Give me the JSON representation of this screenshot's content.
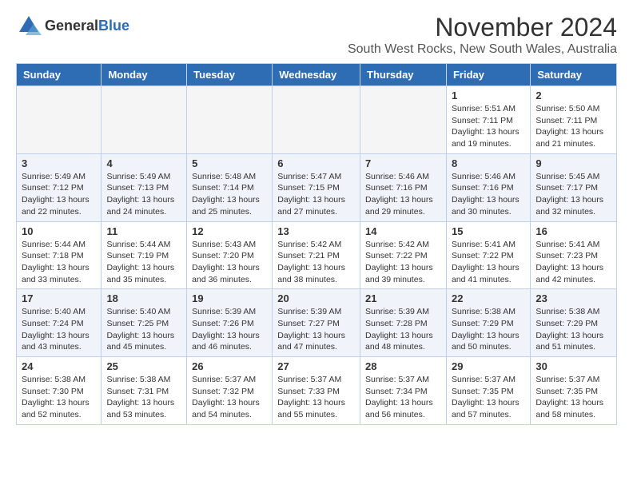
{
  "header": {
    "logo_general": "General",
    "logo_blue": "Blue",
    "month_title": "November 2024",
    "subtitle": "South West Rocks, New South Wales, Australia"
  },
  "days_of_week": [
    "Sunday",
    "Monday",
    "Tuesday",
    "Wednesday",
    "Thursday",
    "Friday",
    "Saturday"
  ],
  "weeks": [
    [
      {
        "day": "",
        "info": ""
      },
      {
        "day": "",
        "info": ""
      },
      {
        "day": "",
        "info": ""
      },
      {
        "day": "",
        "info": ""
      },
      {
        "day": "",
        "info": ""
      },
      {
        "day": "1",
        "info": "Sunrise: 5:51 AM\nSunset: 7:11 PM\nDaylight: 13 hours and 19 minutes."
      },
      {
        "day": "2",
        "info": "Sunrise: 5:50 AM\nSunset: 7:11 PM\nDaylight: 13 hours and 21 minutes."
      }
    ],
    [
      {
        "day": "3",
        "info": "Sunrise: 5:49 AM\nSunset: 7:12 PM\nDaylight: 13 hours and 22 minutes."
      },
      {
        "day": "4",
        "info": "Sunrise: 5:49 AM\nSunset: 7:13 PM\nDaylight: 13 hours and 24 minutes."
      },
      {
        "day": "5",
        "info": "Sunrise: 5:48 AM\nSunset: 7:14 PM\nDaylight: 13 hours and 25 minutes."
      },
      {
        "day": "6",
        "info": "Sunrise: 5:47 AM\nSunset: 7:15 PM\nDaylight: 13 hours and 27 minutes."
      },
      {
        "day": "7",
        "info": "Sunrise: 5:46 AM\nSunset: 7:16 PM\nDaylight: 13 hours and 29 minutes."
      },
      {
        "day": "8",
        "info": "Sunrise: 5:46 AM\nSunset: 7:16 PM\nDaylight: 13 hours and 30 minutes."
      },
      {
        "day": "9",
        "info": "Sunrise: 5:45 AM\nSunset: 7:17 PM\nDaylight: 13 hours and 32 minutes."
      }
    ],
    [
      {
        "day": "10",
        "info": "Sunrise: 5:44 AM\nSunset: 7:18 PM\nDaylight: 13 hours and 33 minutes."
      },
      {
        "day": "11",
        "info": "Sunrise: 5:44 AM\nSunset: 7:19 PM\nDaylight: 13 hours and 35 minutes."
      },
      {
        "day": "12",
        "info": "Sunrise: 5:43 AM\nSunset: 7:20 PM\nDaylight: 13 hours and 36 minutes."
      },
      {
        "day": "13",
        "info": "Sunrise: 5:42 AM\nSunset: 7:21 PM\nDaylight: 13 hours and 38 minutes."
      },
      {
        "day": "14",
        "info": "Sunrise: 5:42 AM\nSunset: 7:22 PM\nDaylight: 13 hours and 39 minutes."
      },
      {
        "day": "15",
        "info": "Sunrise: 5:41 AM\nSunset: 7:22 PM\nDaylight: 13 hours and 41 minutes."
      },
      {
        "day": "16",
        "info": "Sunrise: 5:41 AM\nSunset: 7:23 PM\nDaylight: 13 hours and 42 minutes."
      }
    ],
    [
      {
        "day": "17",
        "info": "Sunrise: 5:40 AM\nSunset: 7:24 PM\nDaylight: 13 hours and 43 minutes."
      },
      {
        "day": "18",
        "info": "Sunrise: 5:40 AM\nSunset: 7:25 PM\nDaylight: 13 hours and 45 minutes."
      },
      {
        "day": "19",
        "info": "Sunrise: 5:39 AM\nSunset: 7:26 PM\nDaylight: 13 hours and 46 minutes."
      },
      {
        "day": "20",
        "info": "Sunrise: 5:39 AM\nSunset: 7:27 PM\nDaylight: 13 hours and 47 minutes."
      },
      {
        "day": "21",
        "info": "Sunrise: 5:39 AM\nSunset: 7:28 PM\nDaylight: 13 hours and 48 minutes."
      },
      {
        "day": "22",
        "info": "Sunrise: 5:38 AM\nSunset: 7:29 PM\nDaylight: 13 hours and 50 minutes."
      },
      {
        "day": "23",
        "info": "Sunrise: 5:38 AM\nSunset: 7:29 PM\nDaylight: 13 hours and 51 minutes."
      }
    ],
    [
      {
        "day": "24",
        "info": "Sunrise: 5:38 AM\nSunset: 7:30 PM\nDaylight: 13 hours and 52 minutes."
      },
      {
        "day": "25",
        "info": "Sunrise: 5:38 AM\nSunset: 7:31 PM\nDaylight: 13 hours and 53 minutes."
      },
      {
        "day": "26",
        "info": "Sunrise: 5:37 AM\nSunset: 7:32 PM\nDaylight: 13 hours and 54 minutes."
      },
      {
        "day": "27",
        "info": "Sunrise: 5:37 AM\nSunset: 7:33 PM\nDaylight: 13 hours and 55 minutes."
      },
      {
        "day": "28",
        "info": "Sunrise: 5:37 AM\nSunset: 7:34 PM\nDaylight: 13 hours and 56 minutes."
      },
      {
        "day": "29",
        "info": "Sunrise: 5:37 AM\nSunset: 7:35 PM\nDaylight: 13 hours and 57 minutes."
      },
      {
        "day": "30",
        "info": "Sunrise: 5:37 AM\nSunset: 7:35 PM\nDaylight: 13 hours and 58 minutes."
      }
    ]
  ]
}
